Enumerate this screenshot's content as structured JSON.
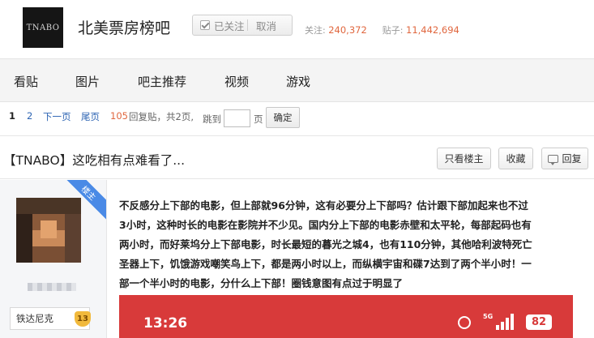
{
  "header": {
    "logo_text": "TNABO",
    "forum_name": "北美票房榜吧",
    "follow_label": "已关注",
    "cancel_label": "取消",
    "followers_label": "关注:",
    "followers_count": "240,372",
    "posts_label": "贴子:",
    "posts_count": "11,442,694"
  },
  "nav": {
    "items": [
      "看贴",
      "图片",
      "吧主推荐",
      "视频",
      "游戏"
    ]
  },
  "pager": {
    "current": "1",
    "page2": "2",
    "next": "下一页",
    "last": "尾页",
    "reply_count": "105",
    "reply_suffix": "回复贴，共2页,",
    "jump_label": "跳到",
    "page_unit": "页",
    "confirm": "确定"
  },
  "thread": {
    "title": "【TNABO】这吃相有点难看了...",
    "buttons": {
      "only_op": "只看楼主",
      "favorite": "收藏",
      "reply": "回复"
    }
  },
  "post": {
    "op_badge": "楼主",
    "user_tag": "铁达尼克",
    "level": "13",
    "lines": [
      "不反感分上下部的电影，但上部就96分钟，这有必要分上下部吗？估计跟下部加起来也不过",
      "3小时，这种时长的电影在影院并不少见。国内分上下部的电影赤壁和太平轮，每部起码也有",
      "两小时，而好莱坞分上下部电影，时长最短的暮光之城4，也有110分钟，其他哈利波特死亡",
      "圣器上下，饥饿游戏嘲笑鸟上下，都是两小时以上，而纵横宇宙和碟7达到了两个半小时！一",
      "部一个半小时的电影，分什么上下部！圈钱意图有点过于明显了"
    ],
    "screenshot": {
      "time": "13:26",
      "network": "5G",
      "battery": "82"
    }
  },
  "colors": {
    "accent_orange": "#e0673f",
    "link_blue": "#2d64b3",
    "op_badge_blue": "#4a8ae6",
    "phone_red": "#d83a3a"
  }
}
